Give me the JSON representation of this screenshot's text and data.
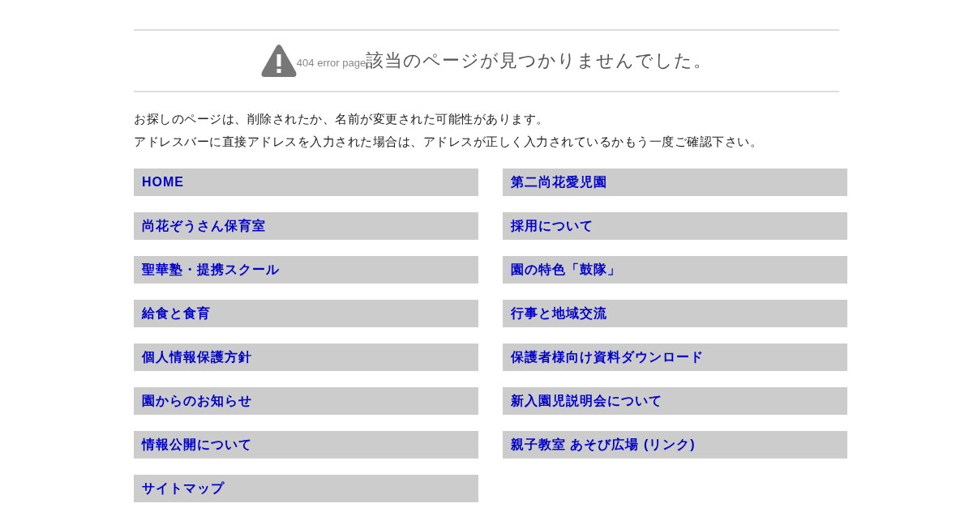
{
  "heading": {
    "error_label": "404 error page",
    "title": "該当のページが見つかりませんでした。"
  },
  "message": [
    "お探しのページは、削除されたか、名前が変更された可能性があります。",
    "アドレスバーに直接アドレスを入力された場合は、アドレスが正しく入力されているかもう一度ご確認下さい。"
  ],
  "links": [
    "HOME",
    "第二尚花愛児園",
    "尚花ぞうさん保育室",
    "採用について",
    "聖華塾・提携スクール",
    "園の特色「鼓隊」",
    "給食と食育",
    "行事と地域交流",
    "個人情報保護方針",
    "保護者様向け資料ダウンロード",
    "園からのお知らせ",
    "新入園児説明会について",
    "情報公開について",
    "親子教室 あそび広場 (リンク)",
    "サイトマップ"
  ]
}
